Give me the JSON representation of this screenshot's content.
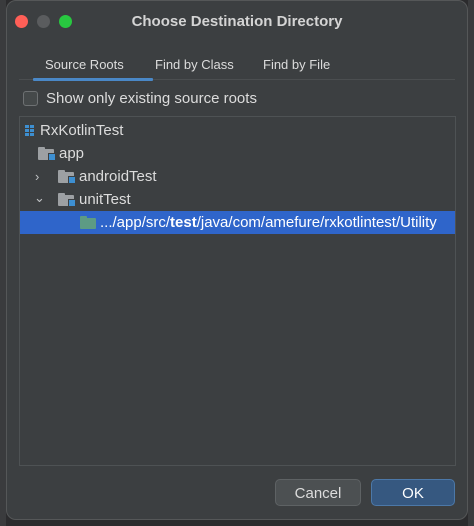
{
  "dialog": {
    "title": "Choose Destination Directory"
  },
  "tabs": [
    {
      "label": "Source Roots",
      "selected": true
    },
    {
      "label": "Find by Class"
    },
    {
      "label": "Find by File"
    }
  ],
  "checkbox": {
    "label": "Show only existing source roots",
    "checked": false
  },
  "tree": {
    "project": "RxKotlinTest",
    "module": "app",
    "androidTest": "androidTest",
    "unitTest": "unitTest",
    "path_prefix": ".../app/src/",
    "path_bold": "test",
    "path_suffix": "/java/com/amefure/rxkotlintest/Utility"
  },
  "buttons": {
    "cancel": "Cancel",
    "ok": "OK"
  },
  "colors": {
    "accent": "#4a88c7",
    "selection": "#2f65ca",
    "close": "#ff5f57",
    "maximize": "#28c840"
  },
  "icons": {
    "module": "module-icon",
    "folder": "folder-icon",
    "test_folder": "test-folder-icon",
    "collapsed": "chevron-right-icon",
    "expanded": "chevron-down-icon"
  }
}
